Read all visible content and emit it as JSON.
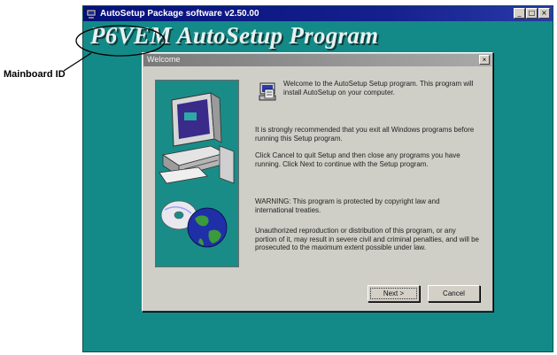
{
  "callout": {
    "label": "Mainboard ID"
  },
  "app_window": {
    "title": "AutoSetup Package software v2.50.00",
    "heading": "P6VEM AutoSetup Program",
    "controls": {
      "minimize": "_",
      "maximize": "□",
      "close": "×"
    },
    "background_color": "#148a88"
  },
  "dialog": {
    "title": "Welcome",
    "close_glyph": "×",
    "paragraphs": [
      "Welcome to the AutoSetup Setup program. This program will install AutoSetup on your computer.",
      "It is strongly recommended that you exit all Windows programs before running this Setup program.",
      "Click Cancel to quit Setup and then close any programs you have running. Click Next to continue with the Setup program.",
      "WARNING: This program is protected by copyright law and international treaties.",
      "Unauthorized reproduction or distribution of this program, or any portion of it, may result in severe civil and criminal penalties, and will be prosecuted to the maximum extent possible under law."
    ],
    "buttons": {
      "next": "Next >",
      "cancel": "Cancel"
    }
  }
}
